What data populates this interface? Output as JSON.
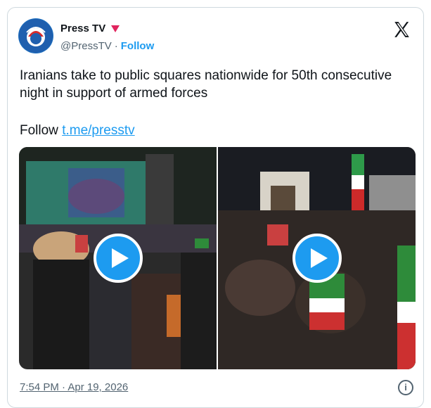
{
  "account": {
    "display_name": "Press TV",
    "handle": "@PressTV",
    "separator": "·",
    "follow_label": "Follow"
  },
  "tweet": {
    "text": "Iranians take to public squares nationwide for 50th consecutive night in support of armed forces",
    "follow_prefix": "Follow",
    "follow_link": "t.me/presstv"
  },
  "media": {
    "videos": [
      {
        "label": "video-1"
      },
      {
        "label": "video-2"
      }
    ]
  },
  "footer": {
    "timestamp": "7:54 PM · Apr 19, 2026",
    "info_glyph": "i"
  },
  "colors": {
    "accent": "#1d9bf0",
    "text": "#0f1419",
    "muted": "#536471",
    "border": "#cfd9de",
    "badge": "#e0245e"
  }
}
